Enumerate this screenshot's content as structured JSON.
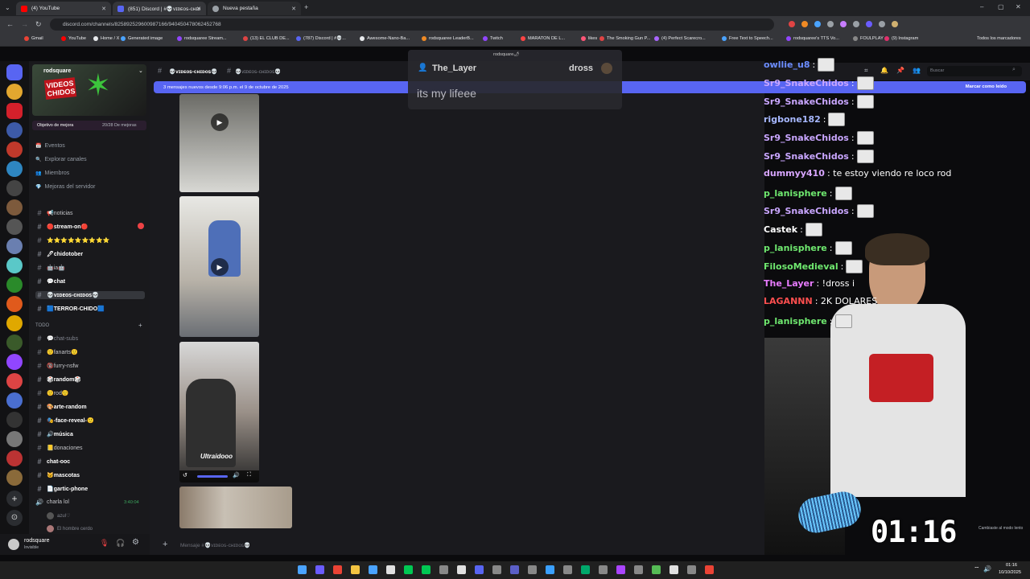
{
  "browser": {
    "tabs": [
      {
        "label": "(4) YouTube",
        "color": "#ff0000"
      },
      {
        "label": "(851) Discord | #💀ᴠɪᴅᴇᴏꜱ-ᴄʜɪᴅ",
        "color": "#5865f2"
      },
      {
        "label": "Nueva pestaña",
        "color": "#9aa0a6"
      }
    ],
    "url": "discord.com/channels/825892529600987166/940450478062452768",
    "bookmarks": [
      "Gmail",
      "YouTube",
      "Home / X",
      "Generated image",
      "rodsquaree Stream...",
      "(13) EL CLUB DE...",
      "(787) Discord | #💀...",
      "Awesome-Nano-Ba...",
      "rodsquaree LeaderB...",
      "Twitch",
      "MARATON DE L...",
      "likes",
      "The Smoking Gun P...",
      "(4) Perfect Scarecro...",
      "Free Text to Speech...",
      "rodsquaree's TTS Vo...",
      "FOULPLAY",
      "(9) Instagram"
    ],
    "all_bookmarks": "Todos los marcadores"
  },
  "server": {
    "name": "rodsquare",
    "banner_text": "VIDEOS CHIDOS",
    "boost_goal": "Objetivo de mejora",
    "boost_count": "20/28 De mejoras",
    "menu": [
      "Eventos",
      "Explorar canales",
      "Miembros",
      "Mejoras del servidor"
    ],
    "channels": [
      {
        "name": "📢noticias",
        "dim": false
      },
      {
        "name": "🔴stream-on🔴",
        "dim": false,
        "bold": true
      },
      {
        "name": "⭐⭐⭐⭐⭐⭐⭐⭐⭐",
        "dim": false
      },
      {
        "name": "🖊chidotober",
        "dim": false,
        "bold": true
      },
      {
        "name": "🤖ia🤖",
        "dim": false
      },
      {
        "name": "💬chat",
        "dim": false,
        "bold": true
      },
      {
        "name": "💀ᴠɪᴅᴇᴏꜱ-ᴄʜɪᴅᴏꜱ💀",
        "dim": false,
        "bold": true,
        "selected": true
      },
      {
        "name": "🟦TERROR-CHIDO🟦",
        "dim": false,
        "bold": true
      }
    ],
    "category": "TODO",
    "channels2": [
      {
        "name": "💬chat-subs",
        "dim": true
      },
      {
        "name": "🙂fanarts🙂",
        "dim": false
      },
      {
        "name": "🔞furry-nsfw",
        "dim": false
      },
      {
        "name": "🎲random🎲",
        "dim": false,
        "bold": true
      },
      {
        "name": "🙂rod🙂",
        "dim": false
      },
      {
        "name": "🎨arte-random",
        "dim": false,
        "bold": true
      },
      {
        "name": "🎭-face-reveal-🙂",
        "dim": false,
        "bold": true
      },
      {
        "name": "🔊música",
        "dim": false,
        "bold": true
      },
      {
        "name": "📒donaciones",
        "dim": false
      },
      {
        "name": "chat-ᴏᴏᴄ",
        "dim": false,
        "bold": true
      },
      {
        "name": "🐱mascotas",
        "dim": false,
        "bold": true
      },
      {
        "name": "📄gartic-phone",
        "dim": false,
        "bold": true
      }
    ],
    "voice_channel": "charla lol",
    "voice_time": "3:40:04",
    "voice_users": [
      "azul♡",
      "El hombre cerdo"
    ],
    "notify_badge": "3"
  },
  "user": {
    "name": "rodsquare",
    "status": "Invisible"
  },
  "channel": {
    "title": "💀ᴠɪᴅᴇᴏꜱ-ᴄʜɪᴅᴏꜱ💀",
    "title2": "💀ᴠɪᴅᴇᴏꜱ-ᴄʜɪᴅᴏꜱ💀",
    "search": "Buscar",
    "new_messages": "3 mensajes nuevos desde 9:06 p.m. el 9 de octubre de 2025",
    "mark_read": "Marcar como leído",
    "composer_placeholder": "Mensaje #💀ᴠɪᴅᴇᴏꜱ-ᴄʜɪᴅᴏꜱ💀",
    "video_caption": "Ultraidooo"
  },
  "popup": {
    "header": "rodsquare🌶",
    "user": "The_Layer",
    "right": "dross",
    "text": "its my lifeee"
  },
  "stream_chat": [
    {
      "user": "owllie_u8",
      "color": "#6b8cff",
      "text": ":",
      "emote": true
    },
    {
      "user": "Sr9_SnakeChidos",
      "color": "#c9a6ff",
      "text": ":",
      "emote": true
    },
    {
      "user": "Sr9_SnakeChidos",
      "color": "#c9a6ff",
      "text": ":",
      "emote": true
    },
    {
      "user": "rigbone182",
      "color": "#a7b8ff",
      "text": ":",
      "emote": true
    },
    {
      "user": "Sr9_SnakeChidos",
      "color": "#c9a6ff",
      "text": ":",
      "emote": true
    },
    {
      "user": "Sr9_SnakeChidos",
      "color": "#c9a6ff",
      "text": ":",
      "emote": true
    },
    {
      "user": "dummyy410",
      "color": "#d8a6ff",
      "text": ": te estoy viendo re loco rod",
      "emote": false
    },
    {
      "user": "p_lanisphere",
      "color": "#6fe86f",
      "text": ":",
      "emote": true
    },
    {
      "user": "Sr9_SnakeChidos",
      "color": "#c9a6ff",
      "text": ":",
      "emote": true
    },
    {
      "user": "Castek",
      "color": "#ffffff",
      "text": ":",
      "emote": true
    },
    {
      "user": "p_lanisphere",
      "color": "#6fe86f",
      "text": ":",
      "emote": true
    },
    {
      "user": "FilosoMedieval",
      "color": "#6fe86f",
      "text": ":",
      "emote": true
    },
    {
      "user": "The_Layer",
      "color": "#e87cff",
      "text": ": !dross i",
      "emote": false
    },
    {
      "user": "LAGANNN",
      "color": "#ff4f4f",
      "text": ": 2K DOLARES",
      "emote": false
    },
    {
      "user": "p_lanisphere",
      "color": "#6fe86f",
      "text": ":",
      "emote": true
    }
  ],
  "timer": "01:16",
  "slow_mode": "Cambiaste al modo lento",
  "clock": {
    "time": "01:16",
    "date": "10/10/2025"
  }
}
